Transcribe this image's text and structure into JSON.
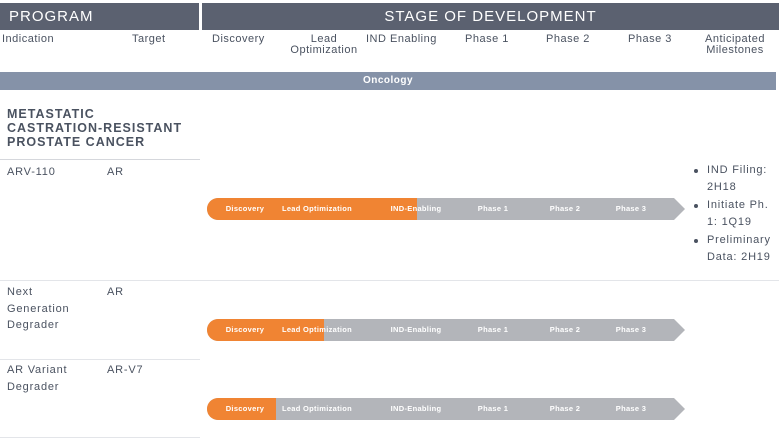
{
  "header": {
    "program": "PROGRAM",
    "stage": "STAGE OF DEVELOPMENT"
  },
  "columns": {
    "indication": "Indication",
    "target": "Target",
    "discovery": "Discovery",
    "lead_opt_line1": "Lead",
    "lead_opt_line2": "Optimization",
    "ind_enabling": "IND Enabling",
    "phase1": "Phase 1",
    "phase2": "Phase 2",
    "phase3": "Phase 3",
    "milestones_line1": "Anticipated",
    "milestones_line2": "Milestones"
  },
  "section": {
    "name": "Oncology",
    "color": "#8592a8"
  },
  "indication": {
    "line1": "METASTATIC",
    "line2": "CASTRATION-RESISTANT",
    "line3": "PROSTATE CANCER"
  },
  "stage_labels": [
    "Discovery",
    "Lead Optimization",
    "IND-Enabling",
    "Phase 1",
    "Phase 2",
    "Phase 3"
  ],
  "colors": {
    "progress": "#f08433",
    "remaining": "#b3b5ba",
    "header_bg": "#5b6170"
  },
  "programs": [
    {
      "name_lines": [
        "ARV-110"
      ],
      "target": "AR",
      "progress_fraction": 0.44,
      "milestones": [
        "IND Filing: 2H18",
        "Initiate Ph. 1: 1Q19",
        "Preliminary Data: 2H19"
      ]
    },
    {
      "name_lines": [
        "Next",
        "Generation",
        "Degrader"
      ],
      "target": "AR",
      "progress_fraction": 0.245
    },
    {
      "name_lines": [
        "AR Variant",
        "Degrader"
      ],
      "target": "AR-V7",
      "progress_fraction": 0.145
    }
  ]
}
